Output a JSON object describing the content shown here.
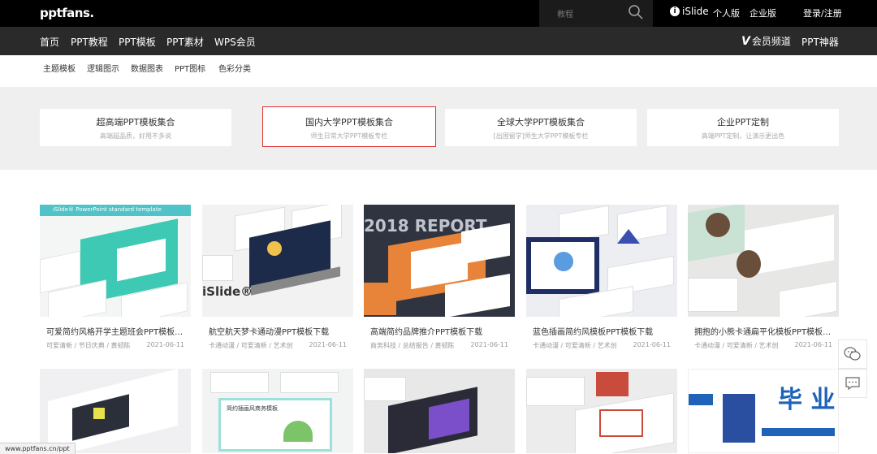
{
  "header": {
    "logo": "pptfans.",
    "search_placeholder": "教程",
    "islide_label": "iSlide",
    "personal": "个人版",
    "enterprise": "企业版",
    "login": "登录/注册"
  },
  "nav": {
    "items": [
      "首页",
      "PPT教程",
      "PPT模板",
      "PPT素材",
      "WPS会员"
    ],
    "vip": "会员频道",
    "ppt_tool": "PPT神器"
  },
  "subnav": [
    "主题模板",
    "逻辑图示",
    "数据图表",
    "PPT图标",
    "色彩分类"
  ],
  "collections": [
    {
      "title": "超高端PPT模板集合",
      "desc": "高端超品质，好用不多说"
    },
    {
      "title": "国内大学PPT模板集合",
      "desc": "师生日常大学PPT模板专栏"
    },
    {
      "title": "全球大学PPT模板集合",
      "desc": "[出国留学]师生大学PPT模板专栏"
    },
    {
      "title": "企业PPT定制",
      "desc": "高端PPT定制，让演示更出色"
    }
  ],
  "cards": [
    {
      "title": "可爱简约风格开学主题班会PPT模板…",
      "tags": "可爱清新 / 节日庆典 / 黄韧陈",
      "date": "2021-06-11",
      "thumb_text": "iSlide® PowerPoint   standard template"
    },
    {
      "title": "航空航天梦卡通动漫PPT模板下载",
      "tags": "卡通动漫 / 可爱清新 / 艺术创",
      "date": "2021-06-11",
      "thumb_text": "iSlide®"
    },
    {
      "title": "高端简约品牌推介PPT模板下载",
      "tags": "商务科技 / 总结报告 / 黄韧陈",
      "date": "2021-06-11",
      "thumb_text": "2018 REPORT"
    },
    {
      "title": "蓝色插画简约风模板PPT模板下载",
      "tags": "卡通动漫 / 可爱清新 / 艺术创",
      "date": "2021-06-11",
      "thumb_text": ""
    },
    {
      "title": "拥抱的小熊卡通扁平化模板PPT模板…",
      "tags": "卡通动漫 / 可爱清新 / 艺术创",
      "date": "2021-06-11",
      "thumb_text": ""
    }
  ],
  "row2_thumbs": [
    "",
    "简约插画风商务模板",
    "",
    "",
    "毕 业"
  ],
  "status_url": "www.pptfans.cn/ppt",
  "colors": {
    "topbar": "#000000",
    "navbar": "#2a2a2a",
    "active_border": "#e0302d",
    "band": "#efefef"
  }
}
